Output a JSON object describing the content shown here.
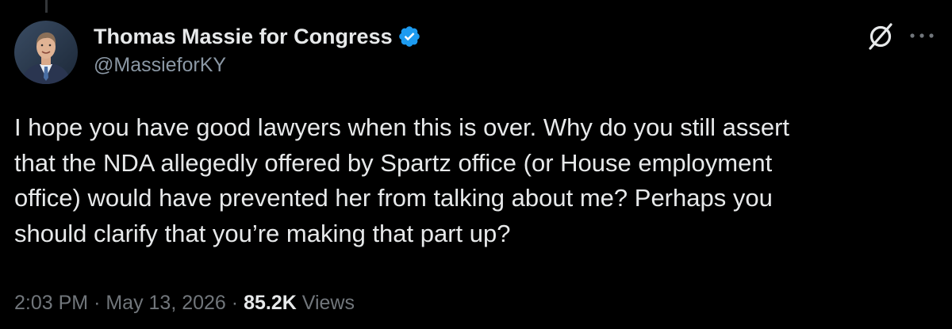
{
  "tweet": {
    "author": {
      "display_name": "Thomas Massie for Congress",
      "handle": "@MassieforKY",
      "verified": true,
      "verified_color": "#1d9bf0"
    },
    "text_lines": [
      "I hope you have good lawyers when this is over. Why do you still assert",
      "that the NDA allegedly offered by Spartz office (or House employment",
      "office) would have prevented her from talking about me? Perhaps you",
      "should clarify that you’re making that part up?"
    ],
    "time": "2:03 PM",
    "date": "May 13, 2026",
    "separator": "·",
    "views_count": "85.2K",
    "views_label": "Views"
  },
  "icons": {
    "header_right": [
      "grok-icon",
      "more-options-icon"
    ],
    "avatar": "author-avatar"
  },
  "colors": {
    "background": "#000000",
    "primary_text": "#e7e9ea",
    "secondary_text": "#71767b",
    "accent": "#1d9bf0"
  }
}
